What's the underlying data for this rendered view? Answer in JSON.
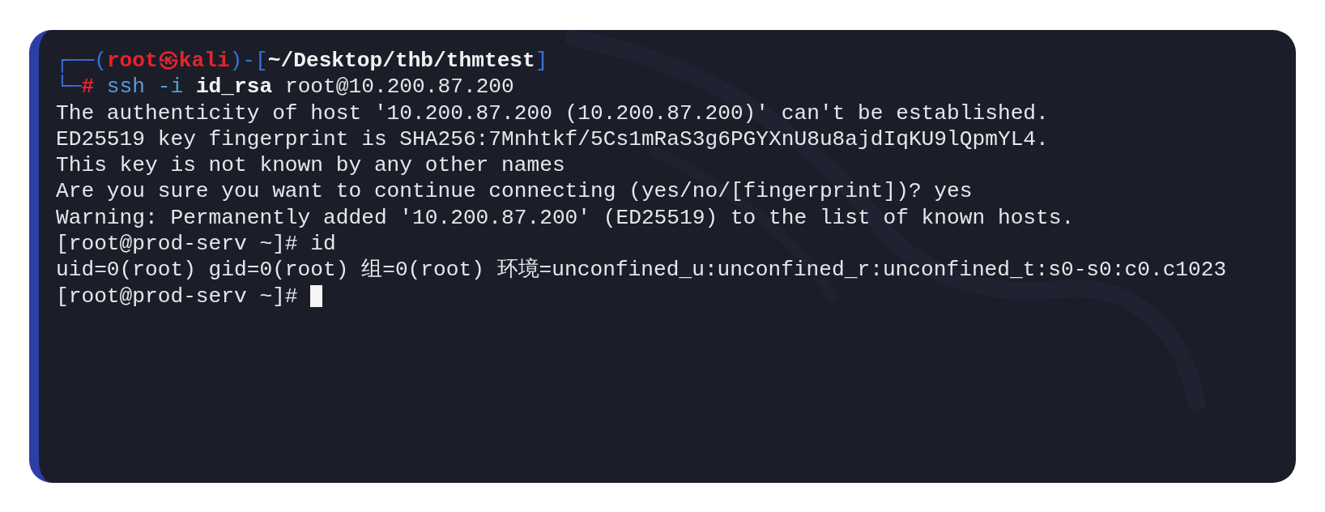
{
  "terminal": {
    "lines": [
      {
        "segments": [
          {
            "kind": "frame",
            "text": "┌──("
          },
          {
            "kind": "user",
            "text": "root㉿kali"
          },
          {
            "kind": "frame",
            "text": ")-["
          },
          {
            "kind": "path",
            "text": "~/Desktop/thb/thmtest"
          },
          {
            "kind": "frame",
            "text": "]"
          }
        ]
      },
      {
        "segments": [
          {
            "kind": "frame",
            "text": "└─"
          },
          {
            "kind": "hash",
            "text": "#"
          },
          {
            "kind": "command",
            "text": " ssh"
          },
          {
            "kind": "flag",
            "text": " -i"
          },
          {
            "kind": "bold",
            "text": " id_rsa"
          },
          {
            "kind": "plain",
            "text": " root@10.200.87.200"
          }
        ]
      },
      {
        "segments": [
          {
            "kind": "plain",
            "text": "The authenticity of host '10.200.87.200 (10.200.87.200)' can't be established."
          }
        ]
      },
      {
        "segments": [
          {
            "kind": "plain",
            "text": "ED25519 key fingerprint is SHA256:7Mnhtkf/5Cs1mRaS3g6PGYXnU8u8ajdIqKU9lQpmYL4."
          }
        ]
      },
      {
        "segments": [
          {
            "kind": "plain",
            "text": "This key is not known by any other names"
          }
        ]
      },
      {
        "segments": [
          {
            "kind": "plain",
            "text": "Are you sure you want to continue connecting (yes/no/[fingerprint])? yes"
          }
        ]
      },
      {
        "segments": [
          {
            "kind": "plain",
            "text": "Warning: Permanently added '10.200.87.200' (ED25519) to the list of known hosts."
          }
        ]
      },
      {
        "segments": [
          {
            "kind": "plain",
            "text": "[root@prod-serv ~]# id"
          }
        ]
      },
      {
        "segments": [
          {
            "kind": "plain",
            "text": "uid=0(root) gid=0(root) 组=0(root) 环境=unconfined_u:unconfined_r:unconfined_t:s0-s0:c0.c1023"
          }
        ]
      },
      {
        "segments": [
          {
            "kind": "plain",
            "text": "[root@prod-serv ~]# "
          }
        ],
        "cursor": true
      }
    ]
  }
}
